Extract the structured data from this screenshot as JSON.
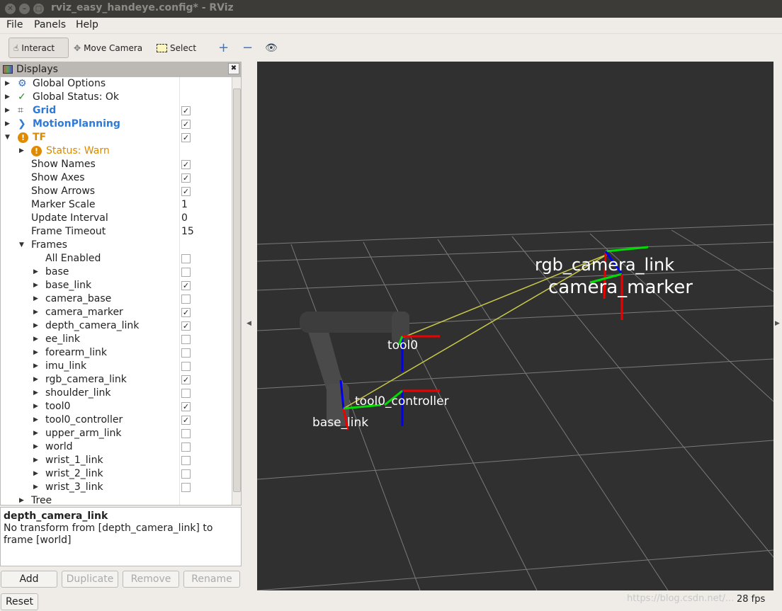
{
  "window": {
    "title": "rviz_easy_handeye.config* - RViz"
  },
  "menu": [
    "File",
    "Panels",
    "Help"
  ],
  "toolbar": {
    "interact": "Interact",
    "move_camera": "Move Camera",
    "select": "Select"
  },
  "displays": {
    "title": "Displays",
    "rows": [
      {
        "label": "Global Options",
        "indent": 0,
        "arrow": "right",
        "icon": "gear-icon"
      },
      {
        "label": "Global Status: Ok",
        "indent": 0,
        "arrow": "right",
        "icon": "check-icon"
      },
      {
        "label": "Grid",
        "indent": 0,
        "arrow": "right",
        "icon": "grid-icon",
        "checked": true,
        "style": "blue"
      },
      {
        "label": "MotionPlanning",
        "indent": 0,
        "arrow": "right",
        "icon": "motion-planning-icon",
        "checked": true,
        "style": "blue"
      },
      {
        "label": "TF",
        "indent": 0,
        "arrow": "down",
        "icon": "warning-icon",
        "checked": true,
        "style": "orange"
      },
      {
        "label": "Status: Warn",
        "indent": 1,
        "arrow": "right",
        "icon": "warning-icon",
        "style": "orange-plain"
      },
      {
        "label": "Show Names",
        "indent": 1,
        "checked": true
      },
      {
        "label": "Show Axes",
        "indent": 1,
        "checked": true
      },
      {
        "label": "Show Arrows",
        "indent": 1,
        "checked": true
      },
      {
        "label": "Marker Scale",
        "indent": 1,
        "value": "1"
      },
      {
        "label": "Update Interval",
        "indent": 1,
        "value": "0"
      },
      {
        "label": "Frame Timeout",
        "indent": 1,
        "value": "15"
      },
      {
        "label": "Frames",
        "indent": 1,
        "arrow": "down"
      },
      {
        "label": "All Enabled",
        "indent": 2,
        "checked": false
      },
      {
        "label": "base",
        "indent": 2,
        "arrow": "right",
        "checked": false
      },
      {
        "label": "base_link",
        "indent": 2,
        "arrow": "right",
        "checked": true
      },
      {
        "label": "camera_base",
        "indent": 2,
        "arrow": "right",
        "checked": false
      },
      {
        "label": "camera_marker",
        "indent": 2,
        "arrow": "right",
        "checked": true
      },
      {
        "label": "depth_camera_link",
        "indent": 2,
        "arrow": "right",
        "checked": true
      },
      {
        "label": "ee_link",
        "indent": 2,
        "arrow": "right",
        "checked": false
      },
      {
        "label": "forearm_link",
        "indent": 2,
        "arrow": "right",
        "checked": false
      },
      {
        "label": "imu_link",
        "indent": 2,
        "arrow": "right",
        "checked": false
      },
      {
        "label": "rgb_camera_link",
        "indent": 2,
        "arrow": "right",
        "checked": true
      },
      {
        "label": "shoulder_link",
        "indent": 2,
        "arrow": "right",
        "checked": false
      },
      {
        "label": "tool0",
        "indent": 2,
        "arrow": "right",
        "checked": true
      },
      {
        "label": "tool0_controller",
        "indent": 2,
        "arrow": "right",
        "checked": true
      },
      {
        "label": "upper_arm_link",
        "indent": 2,
        "arrow": "right",
        "checked": false
      },
      {
        "label": "world",
        "indent": 2,
        "arrow": "right",
        "checked": false
      },
      {
        "label": "wrist_1_link",
        "indent": 2,
        "arrow": "right",
        "checked": false
      },
      {
        "label": "wrist_2_link",
        "indent": 2,
        "arrow": "right",
        "checked": false
      },
      {
        "label": "wrist_3_link",
        "indent": 2,
        "arrow": "right",
        "checked": false
      },
      {
        "label": "Tree",
        "indent": 1,
        "arrow": "right"
      }
    ]
  },
  "description": {
    "title": "depth_camera_link",
    "text": "No transform from [depth_camera_link] to frame [world]"
  },
  "buttons": {
    "add": "Add",
    "duplicate": "Duplicate",
    "remove": "Remove",
    "rename": "Rename",
    "reset": "Reset"
  },
  "scene": {
    "labels": {
      "rgb_camera_link": "rgb_camera_link",
      "camera_marker": "camera_marker",
      "tool0": "tool0",
      "tool0_controller": "tool0_controller",
      "base_link": "base_link"
    }
  },
  "status": {
    "fps": "28 fps"
  },
  "watermark": "https://blog.csdn.net/..."
}
